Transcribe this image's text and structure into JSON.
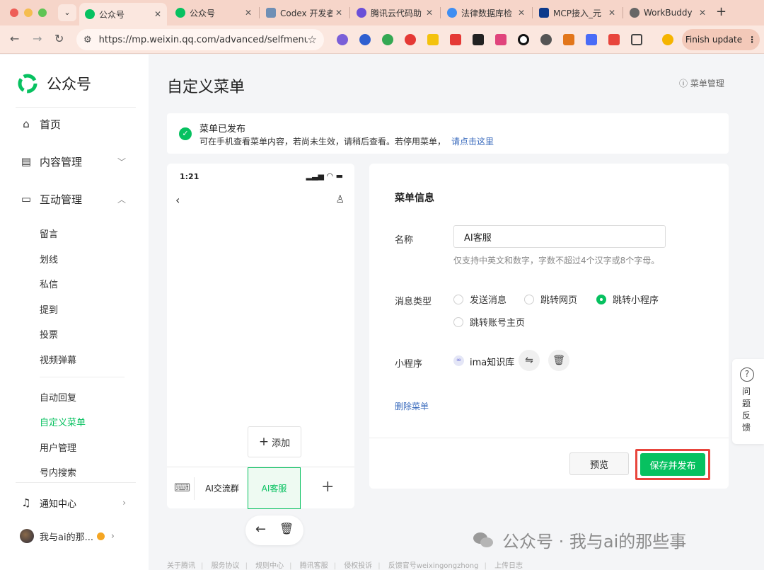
{
  "browser": {
    "tabs": [
      {
        "title": "公众号",
        "active": true,
        "color": "#07c160"
      },
      {
        "title": "公众号",
        "active": false,
        "color": "#07c160"
      },
      {
        "title": "Codex 开发者",
        "active": false,
        "color": "#6f8fb5"
      },
      {
        "title": "腾讯云代码助",
        "active": false,
        "color": "#6b4fd8"
      },
      {
        "title": "法律数据库检",
        "active": false,
        "color": "#3f8ef2"
      },
      {
        "title": "MCP接入_元",
        "active": false,
        "color": "#0d3a8c"
      },
      {
        "title": "WorkBuddy",
        "active": false,
        "color": "#666666"
      }
    ],
    "url": "https://mp.weixin.qq.com/advanced/selfmenu...",
    "finish_update": "Finish update"
  },
  "sidebar": {
    "logo_text": "公众号",
    "nav": {
      "home": "首页",
      "content": "内容管理",
      "interaction": "互动管理",
      "notify": "通知中心"
    },
    "interaction_items": [
      "留言",
      "划线",
      "私信",
      "提到",
      "投票",
      "视频弹幕"
    ],
    "more_items": [
      "自动回复",
      "自定义菜单",
      "用户管理",
      "号内搜索"
    ],
    "active_item": "自定义菜单",
    "user_name": "我与ai的那..."
  },
  "header": {
    "title": "自定义菜单",
    "menu_mgmt": "菜单管理"
  },
  "notice": {
    "title": "菜单已发布",
    "desc": "可在手机查看菜单内容，若尚未生效，请稍后查看。若停用菜单，",
    "link": "请点击这里"
  },
  "phone": {
    "time": "1:21",
    "menu1": "AI交流群",
    "menu2": "AI客服",
    "add_label": "添加"
  },
  "form": {
    "section_title": "菜单信息",
    "name_label": "名称",
    "name_value": "AI客服",
    "name_hint": "仅支持中英文和数字，字数不超过4个汉字或8个字母。",
    "type_label": "消息类型",
    "types": [
      "发送消息",
      "跳转网页",
      "跳转小程序",
      "跳转账号主页"
    ],
    "selected_type": "跳转小程序",
    "mini_label": "小程序",
    "mini_name": "ima知识库",
    "delete_menu": "删除菜单",
    "preview_btn": "预览",
    "publish_btn": "保存并发布"
  },
  "feedback": {
    "label": "问题反馈"
  },
  "footer": [
    "关于腾讯",
    "服务协议",
    "规则中心",
    "腾讯客服",
    "侵权投诉",
    "反馈官号weixingongzhong",
    "上传日志"
  ],
  "watermark": "公众号 · 我与ai的那些事",
  "colors": {
    "brand_green": "#07c160",
    "highlight_red": "#e8453c",
    "link_blue": "#3a6bbd",
    "tabbar": "#f6d5c9"
  }
}
